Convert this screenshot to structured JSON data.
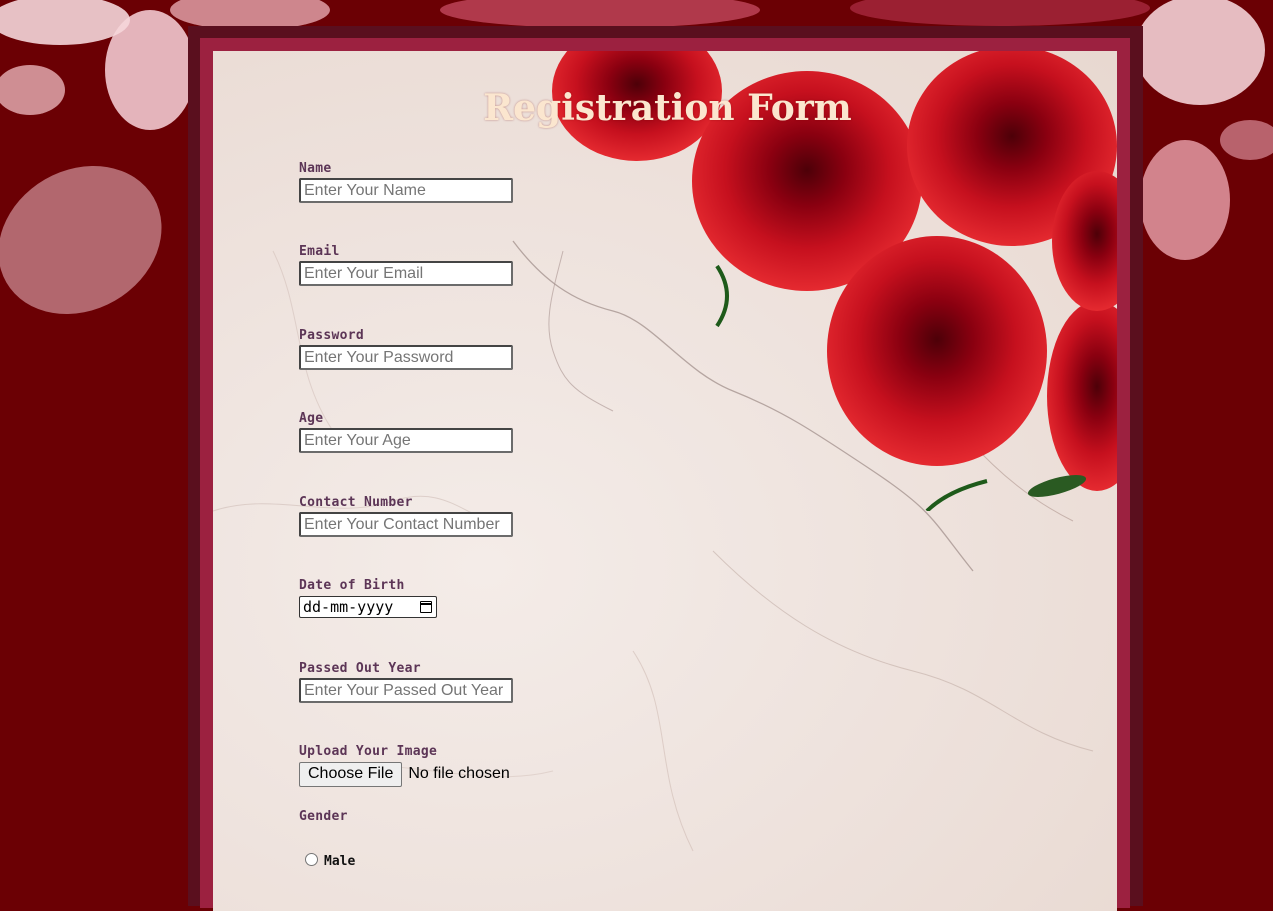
{
  "form": {
    "title": "Registration Form",
    "fields": [
      {
        "label": "Name",
        "placeholder": "Enter Your Name",
        "value": ""
      },
      {
        "label": "Email",
        "placeholder": "Enter Your Email",
        "value": ""
      },
      {
        "label": "Password",
        "placeholder": "Enter Your Password",
        "value": ""
      },
      {
        "label": "Age",
        "placeholder": "Enter Your Age",
        "value": ""
      },
      {
        "label": "Contact Number",
        "placeholder": "Enter Your Contact Number",
        "value": ""
      },
      {
        "label": "Passed Out Year",
        "placeholder": "Enter Your Passed Out Year",
        "value": ""
      }
    ],
    "dob": {
      "label": "Date of Birth",
      "value": "dd-mm-yyyy"
    },
    "upload": {
      "label": "Upload Your Image",
      "button": "Choose File",
      "status": "No file chosen"
    },
    "gender": {
      "label": "Gender",
      "options": [
        "Male"
      ]
    }
  },
  "colors": {
    "page_background": "#6b0004",
    "frame": "#5a0f1e",
    "frame_border": "#9c2140",
    "title": "#fbe6cf",
    "label": "#5c3556"
  }
}
